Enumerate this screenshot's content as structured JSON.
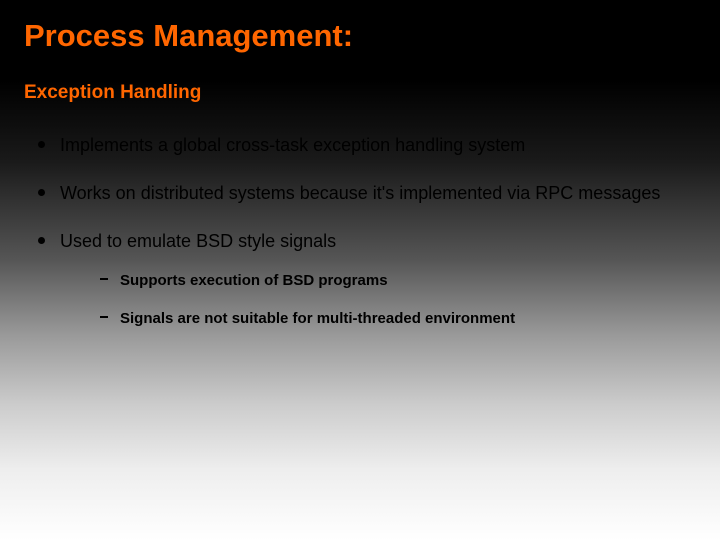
{
  "title": "Process Management:",
  "subtitle": "Exception Handling",
  "bullets": [
    {
      "text": "Implements a global cross-task exception handling system"
    },
    {
      "text": "Works on distributed systems because it's implemented via RPC messages"
    },
    {
      "text": "Used to emulate BSD style signals",
      "sub": [
        "Supports execution of BSD programs",
        "Signals are not suitable for multi-threaded environment"
      ]
    }
  ]
}
